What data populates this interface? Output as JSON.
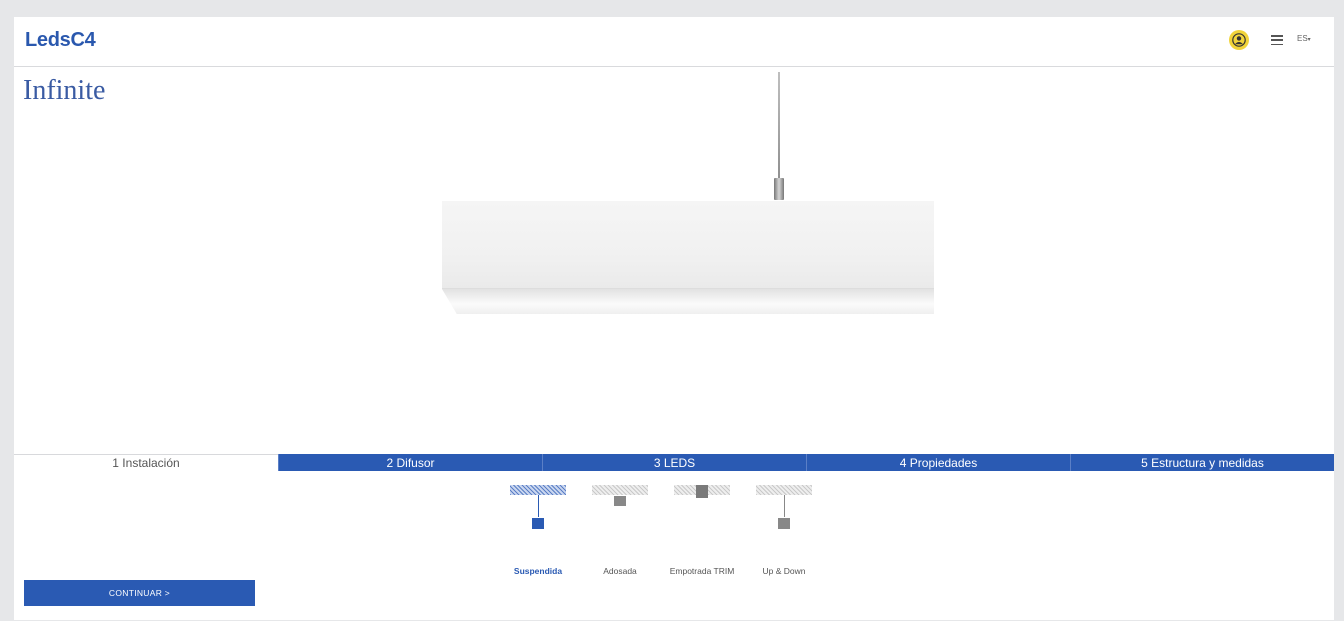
{
  "header": {
    "logo": "LedsC4",
    "language": "ES"
  },
  "product": {
    "title": "Infinite"
  },
  "steps": [
    {
      "label": "1 Instalación",
      "active": true
    },
    {
      "label": "2 Difusor",
      "active": false
    },
    {
      "label": "3 LEDS",
      "active": false
    },
    {
      "label": "4 Propiedades",
      "active": false
    },
    {
      "label": "5 Estructura y medidas",
      "active": false
    }
  ],
  "installation_options": [
    {
      "label": "Suspendida",
      "selected": true
    },
    {
      "label": "Adosada",
      "selected": false
    },
    {
      "label": "Empotrada TRIM",
      "selected": false
    },
    {
      "label": "Up & Down",
      "selected": false
    }
  ],
  "actions": {
    "continue_label": "CONTINUAR >"
  },
  "colors": {
    "brand_blue": "#2a5ab3",
    "user_icon_yellow": "#f1d43a",
    "title_blue": "#3a5ba3"
  },
  "icons": [
    "user-icon",
    "menu-icon",
    "chevron-down-icon"
  ]
}
